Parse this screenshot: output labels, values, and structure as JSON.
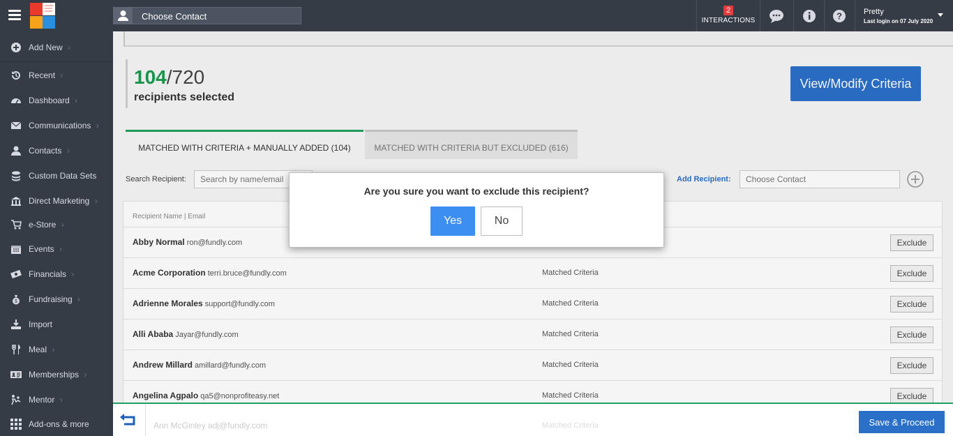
{
  "header": {
    "contact_placeholder": "Choose Contact",
    "interactions_count": "2",
    "interactions_label": "INTERACTIONS",
    "user_name": "Pretty",
    "last_login": "Last login on 07 July 2020"
  },
  "sidebar": {
    "items": [
      {
        "label": "Add New",
        "icon": "plus-circle-icon"
      },
      {
        "label": "Recent",
        "icon": "history-icon"
      },
      {
        "label": "Dashboard",
        "icon": "dashboard-icon"
      },
      {
        "label": "Communications",
        "icon": "envelope-icon"
      },
      {
        "label": "Contacts",
        "icon": "user-icon"
      },
      {
        "label": "Custom Data Sets",
        "icon": "database-icon"
      },
      {
        "label": "Direct Marketing",
        "icon": "bank-icon"
      },
      {
        "label": "e-Store",
        "icon": "cart-icon"
      },
      {
        "label": "Events",
        "icon": "calendar-icon"
      },
      {
        "label": "Financials",
        "icon": "money-icon"
      },
      {
        "label": "Fundraising",
        "icon": "moneybag-icon"
      },
      {
        "label": "Import",
        "icon": "download-icon"
      },
      {
        "label": "Meal",
        "icon": "cutlery-icon"
      },
      {
        "label": "Memberships",
        "icon": "id-card-icon"
      },
      {
        "label": "Mentor",
        "icon": "mentor-icon"
      },
      {
        "label": "Add-ons & more",
        "icon": "grid-icon"
      }
    ]
  },
  "summary": {
    "selected": "104",
    "total": "/720",
    "label": "recipients selected",
    "view_button": "View/Modify Criteria"
  },
  "tabs": [
    {
      "label": "MATCHED WITH CRITERIA + MANUALLY ADDED (104)",
      "active": true
    },
    {
      "label": "MATCHED WITH CRITERIA BUT EXCLUDED (616)",
      "active": false
    }
  ],
  "search": {
    "label": "Search Recipient:",
    "placeholder": "Search by name/email"
  },
  "add": {
    "label": "Add Recipient:",
    "placeholder": "Choose Contact"
  },
  "table": {
    "header": "Recipient Name | Email",
    "exclude_label": "Exclude",
    "rows": [
      {
        "name": "Abby Normal",
        "email": "ron@fundly.com",
        "status": ""
      },
      {
        "name": "Acme Corporation",
        "email": "terri.bruce@fundly.com",
        "status": "Matched Criteria"
      },
      {
        "name": "Adrienne Morales",
        "email": "support@fundly.com",
        "status": "Matched Criteria"
      },
      {
        "name": "Alli Ababa",
        "email": "Jayar@fundly.com",
        "status": "Matched Criteria"
      },
      {
        "name": "Andrew Millard",
        "email": "amillard@fundly.com",
        "status": "Matched Criteria"
      },
      {
        "name": "Angelina Agpalo",
        "email": "qa5@nonprofiteasy.net",
        "status": "Matched Criteria"
      }
    ],
    "ghost_row": {
      "name": "Ann McGinley",
      "email": "adj@fundly.com",
      "status": "Matched Criteria"
    }
  },
  "footer": {
    "save_button": "Save & Proceed"
  },
  "modal": {
    "question": "Are you sure you want to exclude this recipient?",
    "yes": "Yes",
    "no": "No"
  },
  "colors": {
    "accent": "#2a70c9",
    "success": "#1d9b4f",
    "sidebar_bg": "#353c46"
  }
}
